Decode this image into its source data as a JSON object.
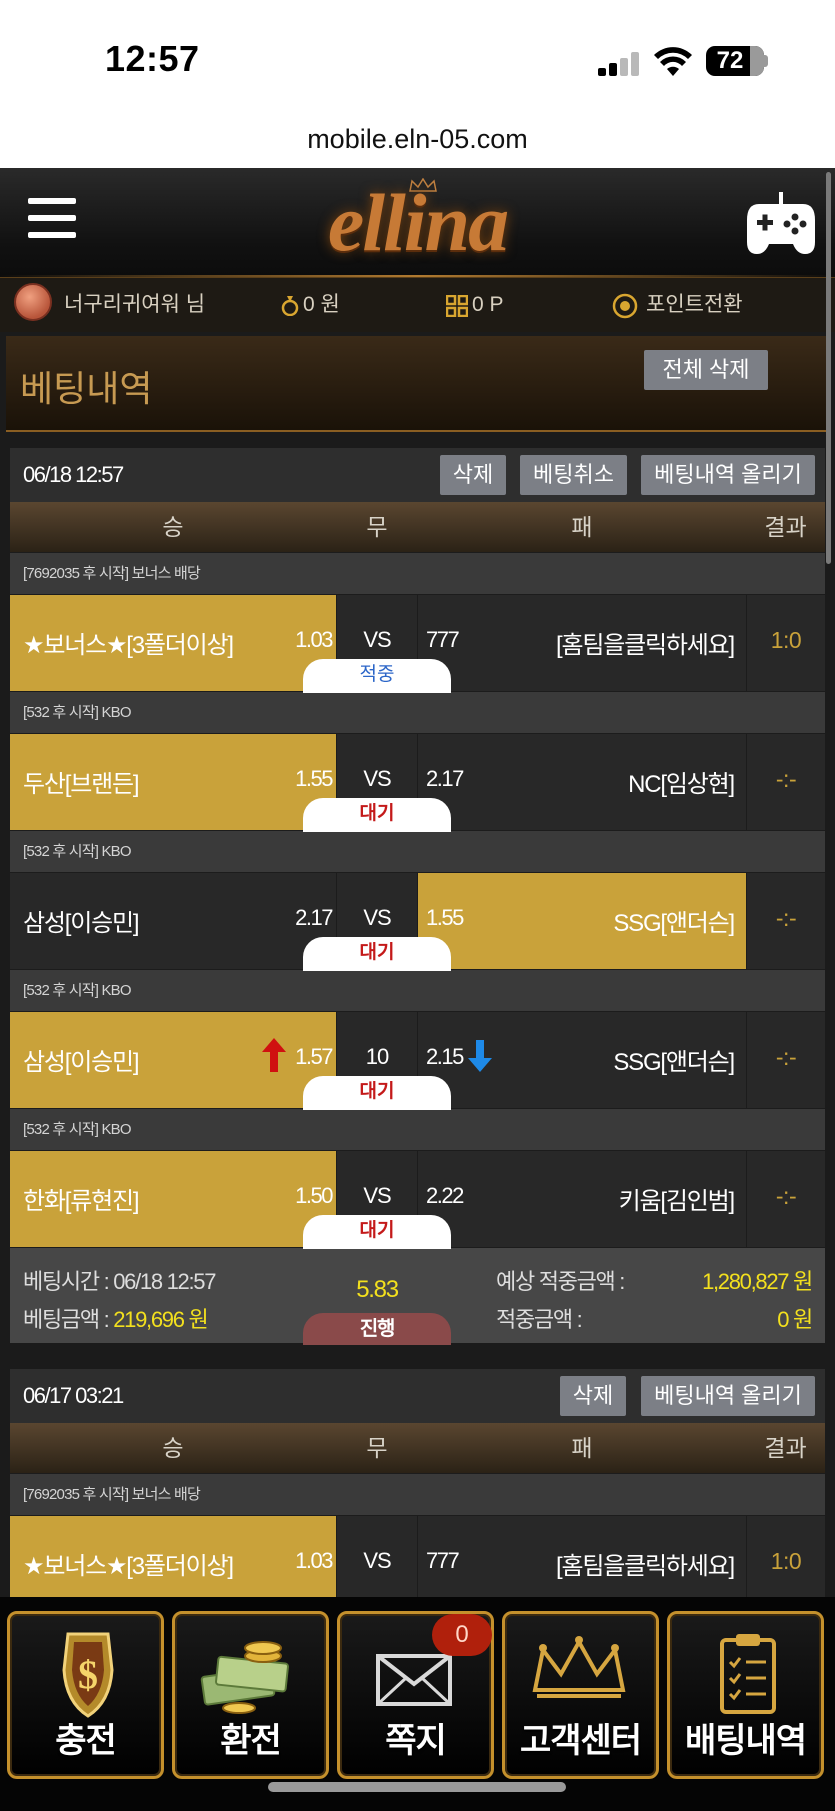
{
  "status_bar": {
    "time": "12:57",
    "battery": "72"
  },
  "browser": {
    "url": "mobile.eln-05.com"
  },
  "header": {
    "logo": "ellina"
  },
  "user_bar": {
    "username": "너구리귀여워 님",
    "money": "0 원",
    "points": "0 P",
    "point_exchange": "포인트전환"
  },
  "page": {
    "title": "베팅내역",
    "delete_all": "전체 삭제"
  },
  "columns": {
    "win": "승",
    "draw": "무",
    "lose": "패",
    "result": "결과"
  },
  "slips": [
    {
      "date": "06/18 12:57",
      "buttons": {
        "delete": "삭제",
        "cancel": "베팅취소",
        "upload": "베팅내역 올리기"
      },
      "games": [
        {
          "league": "[7692035 후 시작] 보너스 배당",
          "home": "★보너스★[3폴더이상]",
          "home_odds": "1.03",
          "draw": "VS",
          "away_odds": "777",
          "away": "[홈팀을클릭하세요]",
          "result": "1:0",
          "status": "적중",
          "selected": "home"
        },
        {
          "league": "[532 후 시작] KBO",
          "home": "두산[브랜든]",
          "home_odds": "1.55",
          "draw": "VS",
          "away_odds": "2.17",
          "away": "NC[임상현]",
          "result": "-:-",
          "status": "대기",
          "selected": "home"
        },
        {
          "league": "[532 후 시작] KBO",
          "home": "삼성[이승민]",
          "home_odds": "2.17",
          "draw": "VS",
          "away_odds": "1.55",
          "away": "SSG[앤더슨]",
          "result": "-:-",
          "status": "대기",
          "selected": "away"
        },
        {
          "league": "[532 후 시작] KBO",
          "home": "삼성[이승민]",
          "home_odds": "1.57",
          "draw": "10",
          "away_odds": "2.15",
          "away": "SSG[앤더슨]",
          "result": "-:-",
          "status": "대기",
          "selected": "home"
        },
        {
          "league": "[532 후 시작] KBO",
          "home": "한화[류현진]",
          "home_odds": "1.50",
          "draw": "VS",
          "away_odds": "2.22",
          "away": "키움[김인범]",
          "result": "-:-",
          "status": "대기",
          "selected": "home"
        }
      ],
      "summary": {
        "bet_time_label": "베팅시간 : ",
        "bet_time": "06/18 12:57",
        "bet_amount_label": "베팅금액 : ",
        "bet_amount": "219,696 원",
        "total_odds": "5.83",
        "expected_label": "예상 적중금액 :",
        "expected": "1,280,827 원",
        "won_label": "적중금액 :",
        "won": "0 원",
        "progress": "진행"
      }
    },
    {
      "date": "06/17 03:21",
      "buttons": {
        "delete": "삭제",
        "upload": "베팅내역 올리기"
      },
      "games": [
        {
          "league": "[7692035 후 시작] 보너스 배당",
          "home": "★보너스★[3폴더이상]",
          "home_odds": "1.03",
          "draw": "VS",
          "away_odds": "777",
          "away": "[홈팀을클릭하세요]",
          "result": "1:0",
          "selected": "home"
        }
      ]
    }
  ],
  "bottom_nav": {
    "charge": "충전",
    "exchange": "환전",
    "message": "쪽지",
    "message_badge": "0",
    "support": "고객센터",
    "history": "배팅내역"
  },
  "colors": {
    "accent_gold": "#c9a23a",
    "win_odds_up": "#d01010",
    "odds_down": "#1e8ae8",
    "highlight_yellow": "#f3e01e"
  }
}
